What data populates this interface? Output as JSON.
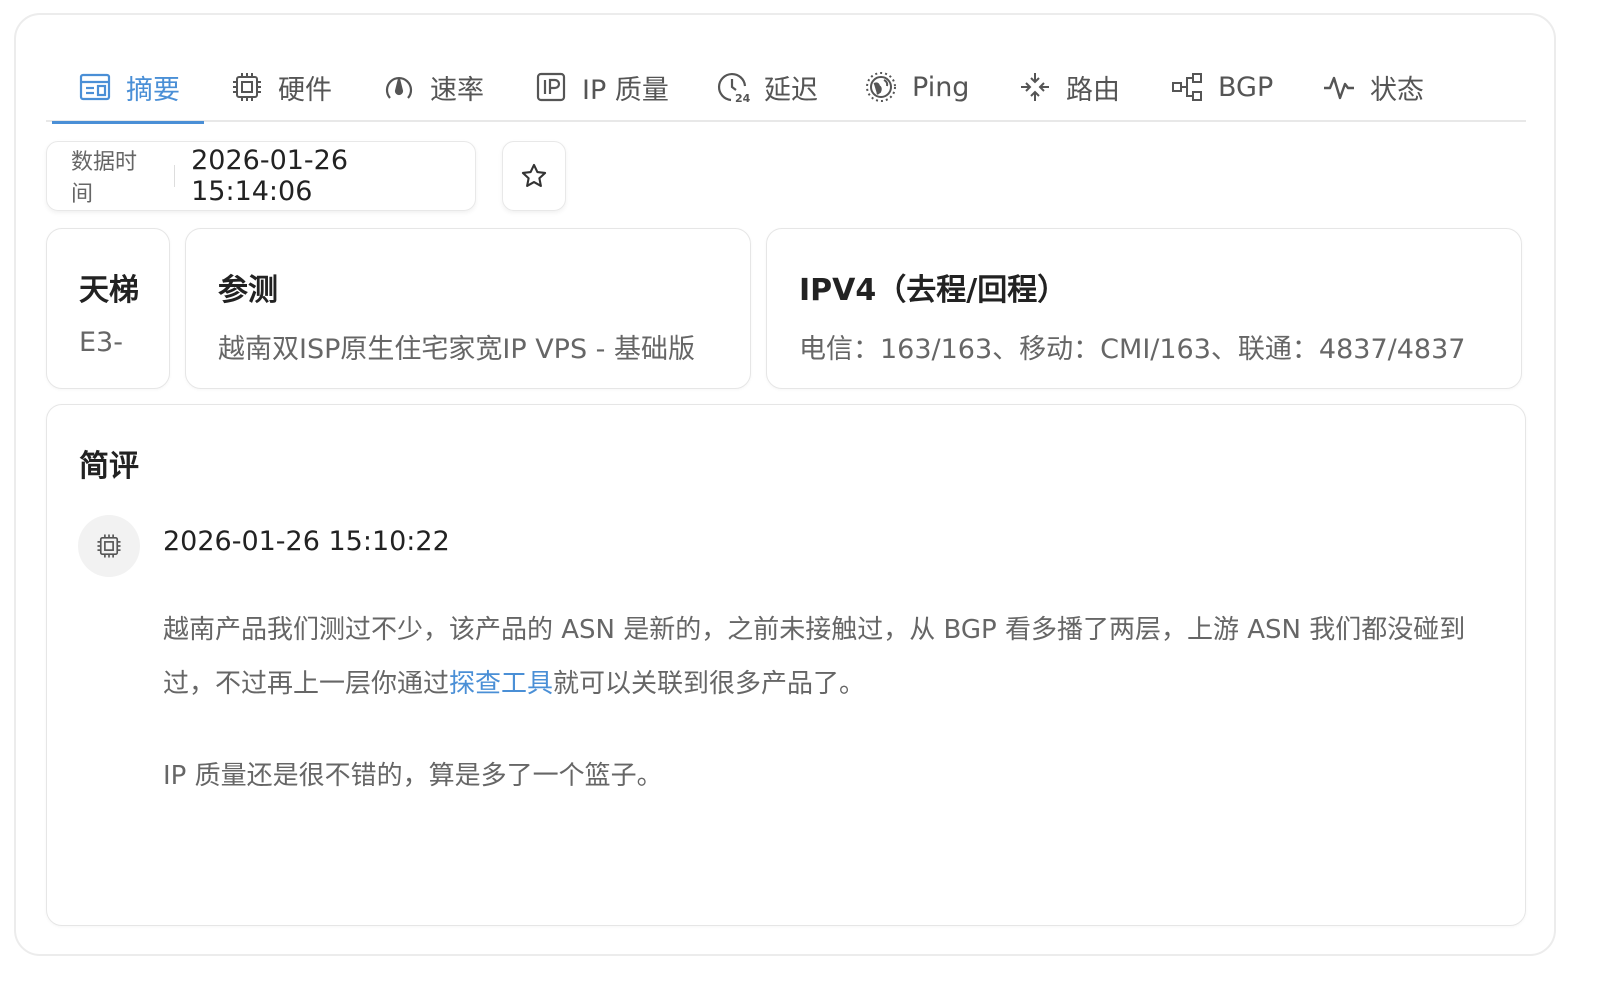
{
  "tabs": [
    {
      "label": "摘要",
      "icon": "summary-icon",
      "active": true
    },
    {
      "label": "硬件",
      "icon": "chip-icon"
    },
    {
      "label": "速率",
      "icon": "speed-icon"
    },
    {
      "label": "IP 质量",
      "icon": "ip-icon"
    },
    {
      "label": "延迟",
      "icon": "latency-24-icon"
    },
    {
      "label": "Ping",
      "icon": "globe-icon"
    },
    {
      "label": "路由",
      "icon": "route-icon"
    },
    {
      "label": "BGP",
      "icon": "bgp-icon"
    },
    {
      "label": "状态",
      "icon": "pulse-icon"
    }
  ],
  "data_time": {
    "label": "数据时间",
    "value": "2026-01-26 15:14:06"
  },
  "cards": {
    "ladder": {
      "title": "天梯",
      "value": "E3-"
    },
    "test": {
      "title": "参测",
      "value": "越南双ISP原生住宅家宽IP VPS - 基础版"
    },
    "ipv4": {
      "title": "IPV4（去程/回程）",
      "value": "电信：163/163、移动：CMI/163、联通：4837/4837"
    }
  },
  "review": {
    "title": "简评",
    "date": "2026-01-26 15:10:22",
    "p1_before": "越南产品我们测过不少，该产品的 ASN 是新的，之前未接触过，从 BGP 看多播了两层，上游 ASN 我们都没碰到过，不过再上一层你通过",
    "p1_link": "探查工具",
    "p1_after": "就可以关联到很多产品了。",
    "p2": "IP 质量还是很不错的，算是多了一个篮子。"
  },
  "colors": {
    "accent": "#4a8fd6",
    "text": "#222222",
    "muted": "#666666",
    "border": "#e6e6e6"
  }
}
